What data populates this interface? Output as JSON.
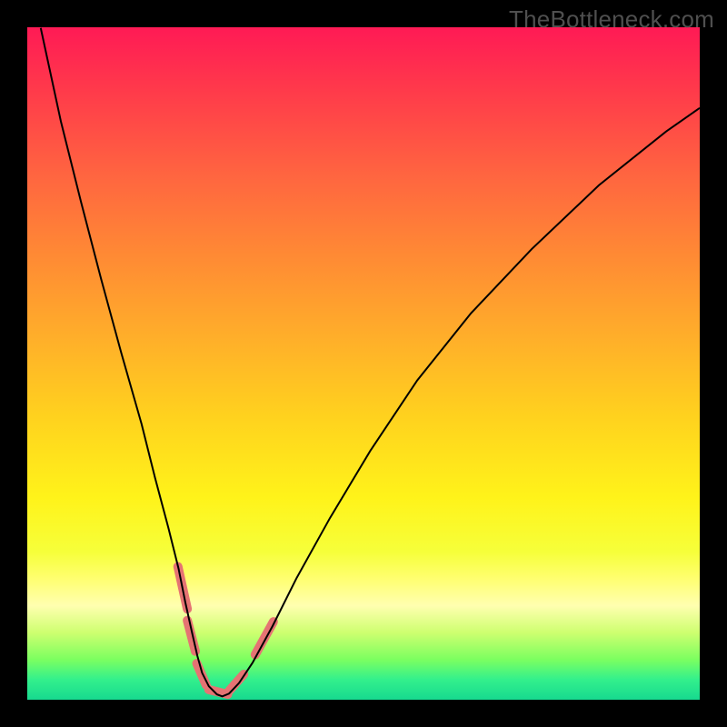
{
  "watermark": "TheBottleneck.com",
  "chart_data": {
    "type": "line",
    "title": "",
    "xlabel": "",
    "ylabel": "",
    "xlim": [
      0,
      100
    ],
    "ylim": [
      0,
      100
    ],
    "grid": false,
    "x_scale_percent": 100,
    "y_scale_percent": 100,
    "series": [
      {
        "name": "bottleneck-curve",
        "x": [
          2,
          5,
          8,
          11,
          14,
          17,
          19,
          21,
          22.5,
          23.5,
          24.5,
          25.3,
          26.0,
          27.0,
          28.2,
          29.0,
          30.0,
          31.5,
          33.5,
          36.5,
          40.0,
          45.0,
          51.0,
          58.0,
          66.0,
          75.0,
          85.0,
          95.0,
          100.0
        ],
        "y": [
          99.9,
          86.0,
          74.0,
          62.5,
          51.5,
          41.0,
          33.0,
          25.5,
          19.5,
          14.5,
          10.0,
          6.5,
          4.0,
          2.0,
          0.8,
          0.5,
          0.9,
          2.5,
          5.5,
          11.0,
          18.0,
          27.0,
          37.0,
          47.5,
          57.5,
          67.0,
          76.5,
          84.5,
          88.0
        ],
        "stroke": "#000000",
        "stroke_width": 2
      },
      {
        "name": "optimal-range-markers",
        "type": "segments",
        "stroke": "#e57373",
        "stroke_width": 10,
        "linecap": "round",
        "segments": [
          {
            "x1": 22.4,
            "y1": 19.8,
            "x2": 23.8,
            "y2": 13.5
          },
          {
            "x1": 23.8,
            "y1": 11.8,
            "x2": 25.0,
            "y2": 7.2
          },
          {
            "x1": 25.2,
            "y1": 5.4,
            "x2": 26.6,
            "y2": 2.2
          },
          {
            "x1": 27.0,
            "y1": 1.5,
            "x2": 29.8,
            "y2": 0.8
          },
          {
            "x1": 30.0,
            "y1": 1.3,
            "x2": 32.2,
            "y2": 3.8
          },
          {
            "x1": 33.9,
            "y1": 6.7,
            "x2": 36.6,
            "y2": 11.6
          }
        ]
      }
    ],
    "annotations": []
  }
}
